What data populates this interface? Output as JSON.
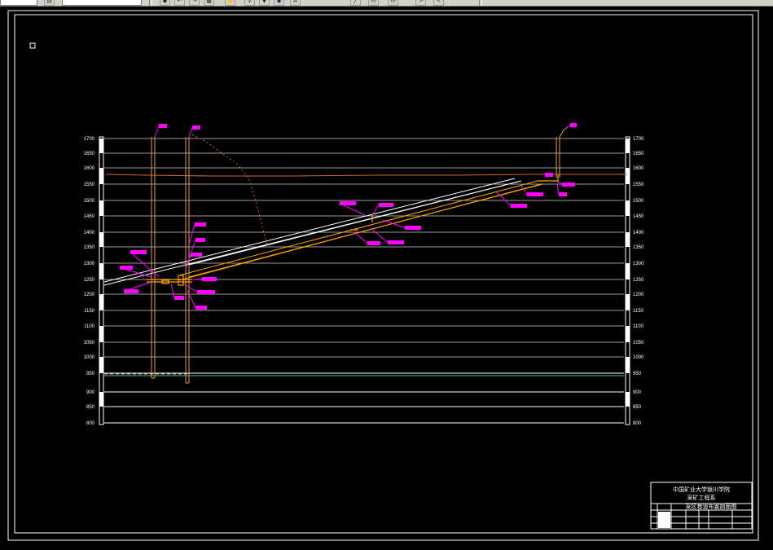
{
  "toolbar": {
    "icons": [
      "open-icon",
      "save-icon",
      "undo-icon",
      "redo-icon",
      "match-icon",
      "pan-icon",
      "zoom-icon",
      "layer-icon",
      "properties-icon",
      "line-icon",
      "polyline-icon",
      "text-icon",
      "dim-icon"
    ]
  },
  "drawing": {
    "elevations": [
      "1700",
      "1650",
      "1600",
      "1550",
      "1500",
      "1450",
      "1400",
      "1350",
      "1300",
      "1250",
      "1200",
      "1150",
      "1100",
      "1050",
      "1000",
      "950",
      "900",
      "850",
      "800"
    ],
    "colors": {
      "background": "#000000",
      "frame": "#ffffff",
      "grid": "#ffffff",
      "surface": "#c86a32",
      "shaft": "#e8a040",
      "roadway": "#ffa500",
      "tag": "#ff00ff",
      "water_level": "#40c0c0"
    }
  },
  "title_block": {
    "school": "中国矿业大学银川学院",
    "department": "采矿工程系",
    "drawing_title": "采区巷道布置剖面图"
  }
}
